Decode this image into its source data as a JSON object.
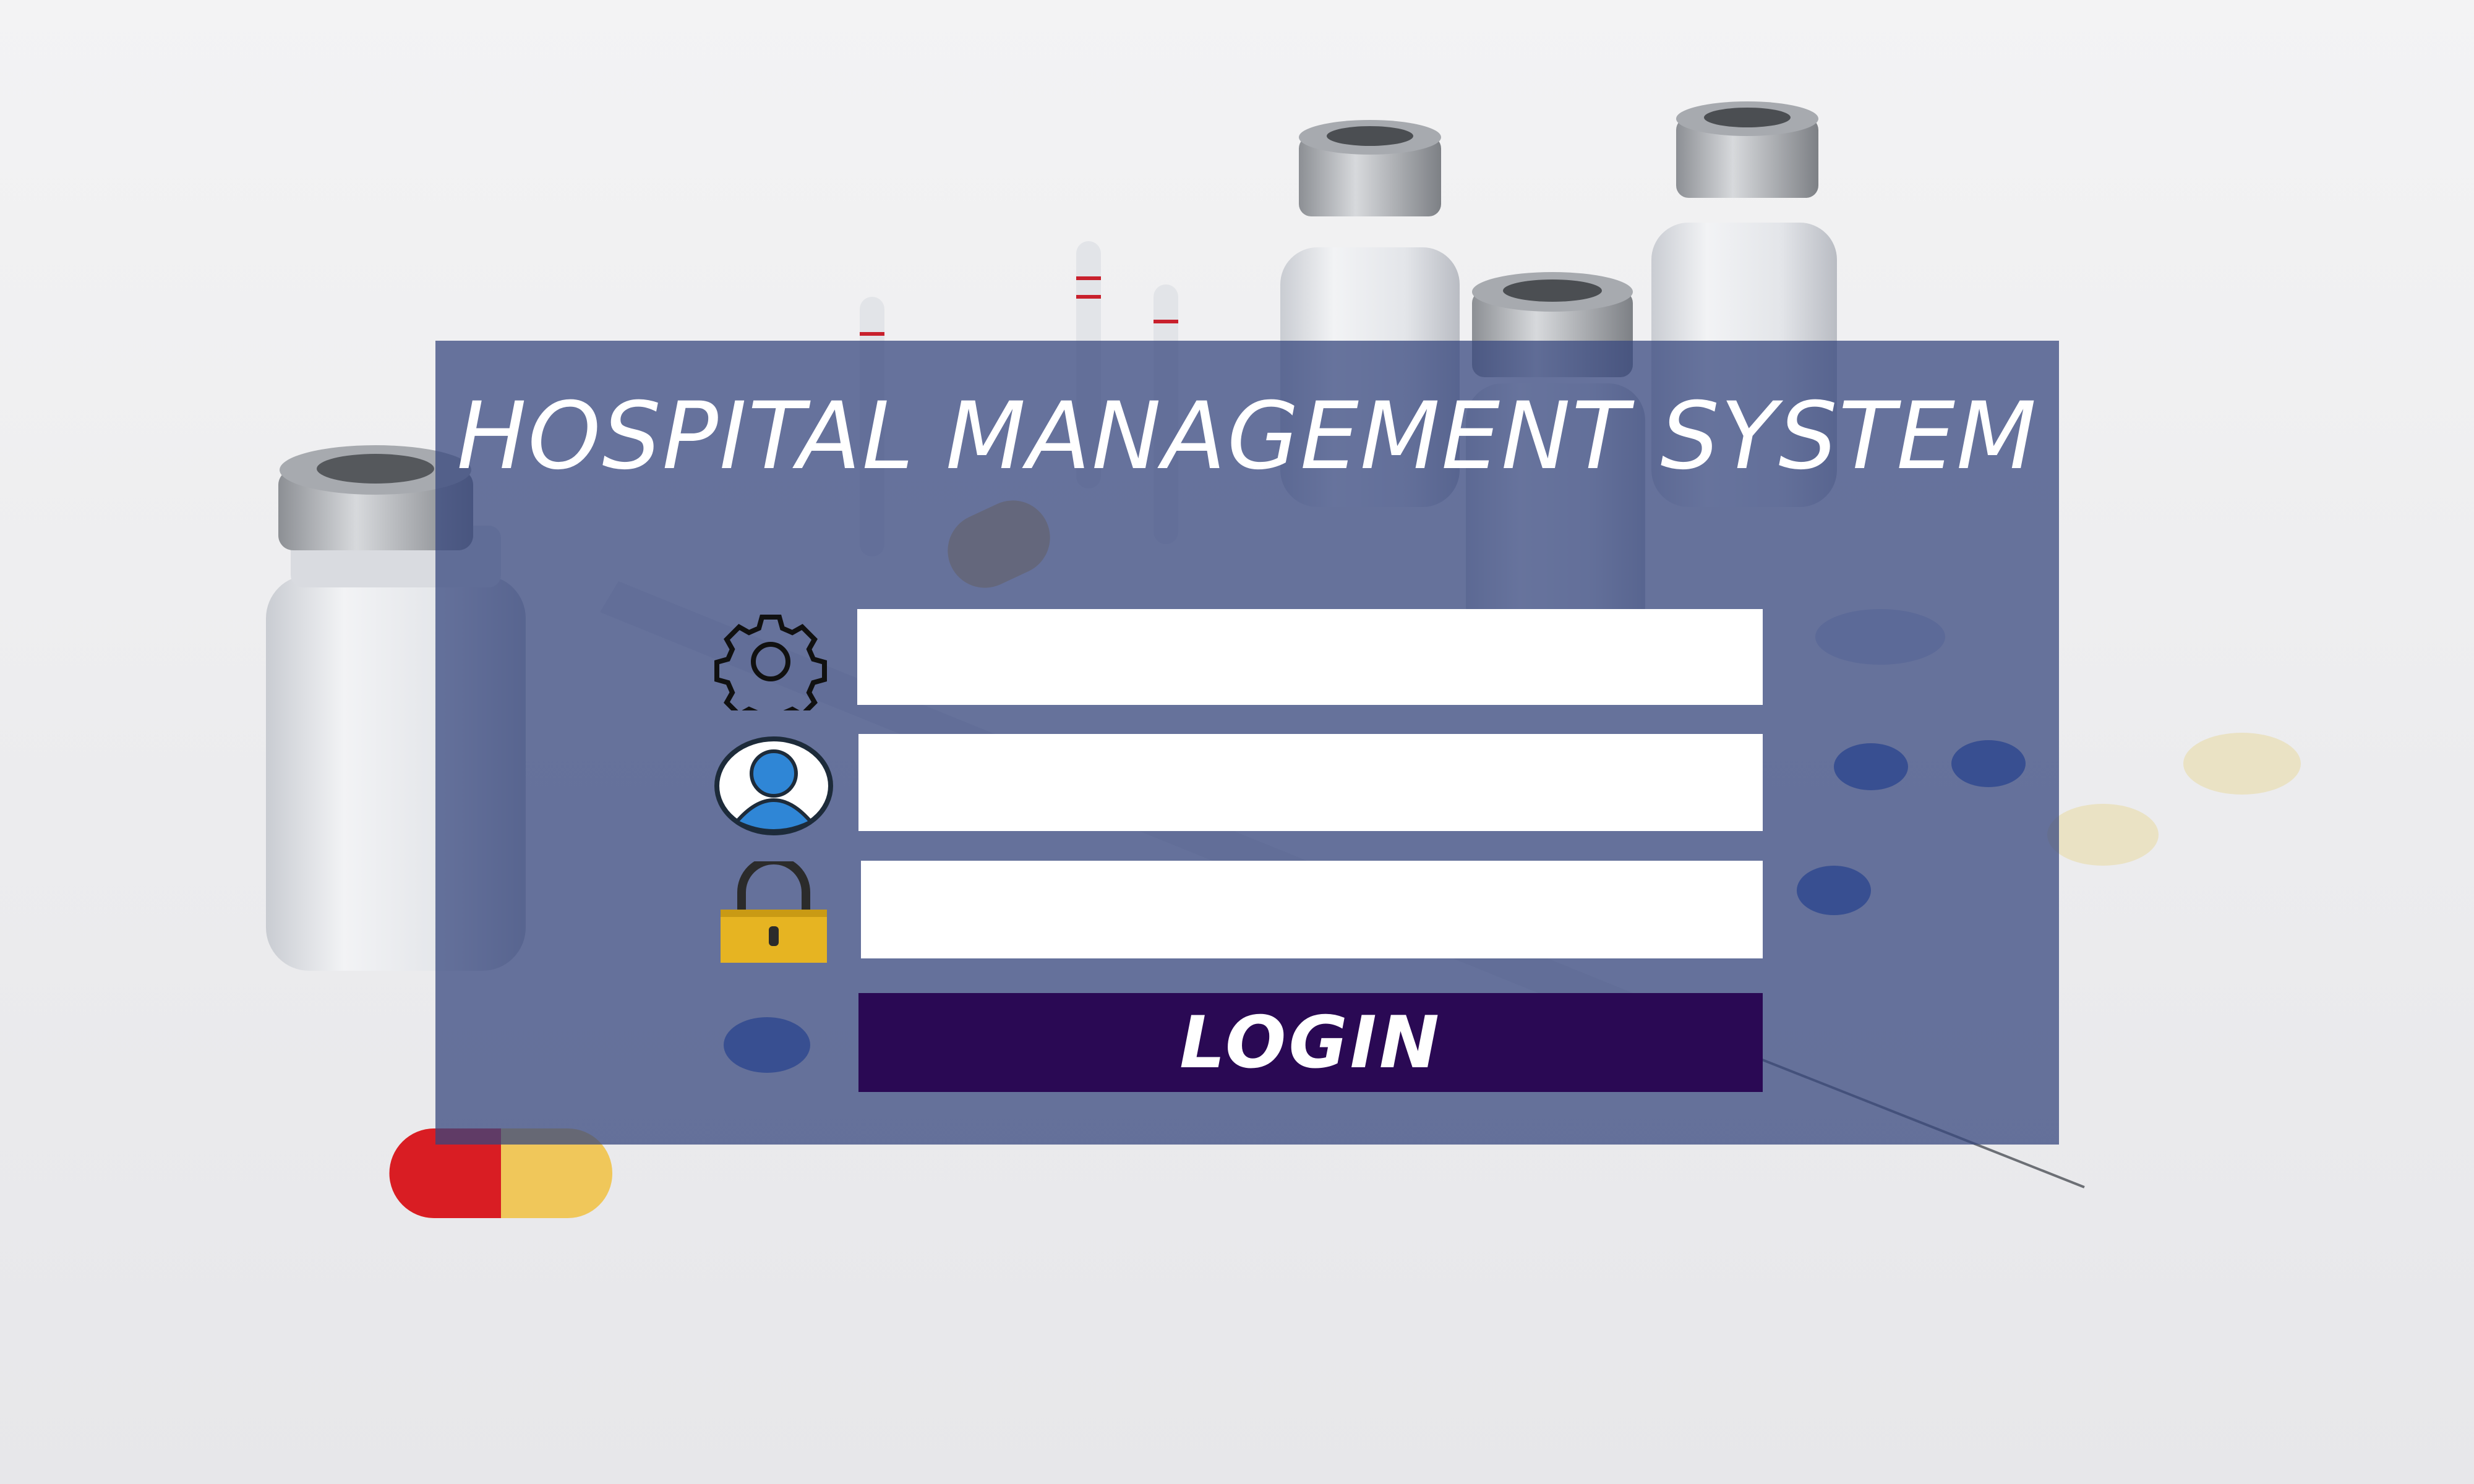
{
  "app": {
    "title": "HOSPITAL MANAGEMENT SYSTEM"
  },
  "form": {
    "fields": [
      {
        "icon": "gear-icon",
        "value": "",
        "placeholder": ""
      },
      {
        "icon": "user-icon",
        "value": "",
        "placeholder": ""
      },
      {
        "icon": "lock-icon",
        "value": "",
        "placeholder": ""
      }
    ],
    "login_label": "LOGIN"
  },
  "colors": {
    "panel": "#36467e",
    "button": "#2a0954",
    "field": "#ffffff",
    "title_text": "#ffffff",
    "lock_body": "#e6b422"
  }
}
